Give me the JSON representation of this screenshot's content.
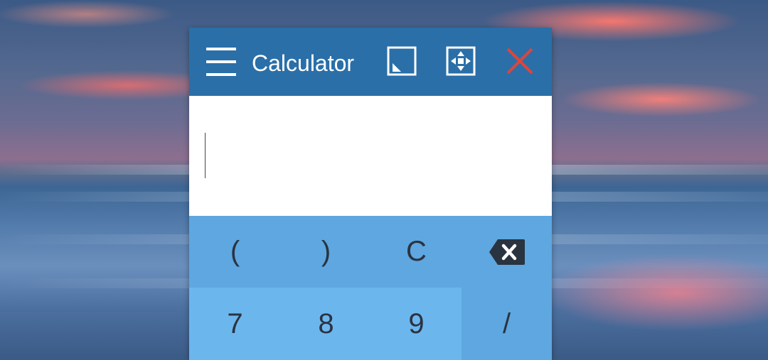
{
  "window": {
    "title": "Calculator",
    "icons": {
      "menu": "hamburger-menu-icon",
      "resize": "resize-icon",
      "move": "move-icon",
      "close": "close-icon"
    },
    "colors": {
      "titlebar": "#2a6fa8",
      "keypad_operator": "#5ea7e0",
      "keypad_number": "#6cb6ee",
      "close": "#e0443a"
    }
  },
  "display": {
    "value": ""
  },
  "keypad": {
    "row1": {
      "open_paren": "(",
      "close_paren": ")",
      "clear": "C",
      "backspace_icon": "backspace-icon"
    },
    "row2": {
      "seven": "7",
      "eight": "8",
      "nine": "9",
      "divide": "/"
    }
  }
}
